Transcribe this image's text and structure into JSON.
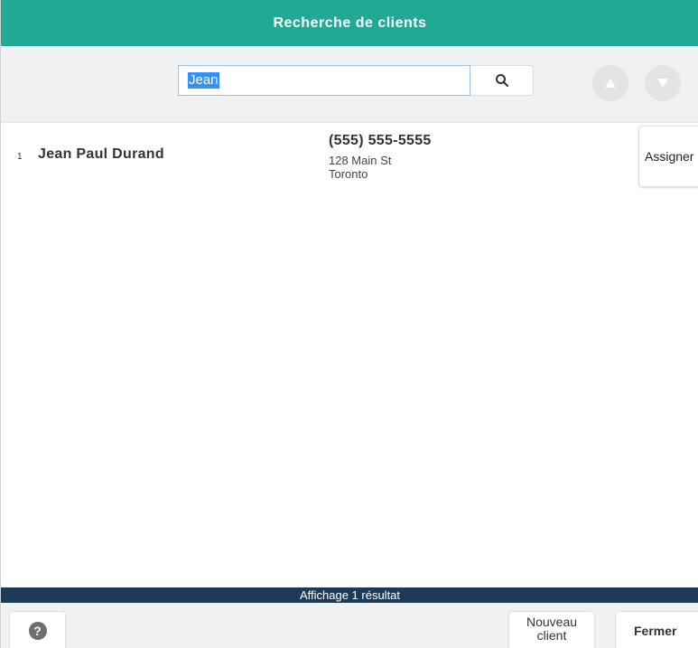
{
  "window": {
    "title": "Recherche de clients"
  },
  "search": {
    "value": "Jean",
    "icon": "search-icon"
  },
  "nav": {
    "up_icon": "triangle-up-icon",
    "down_icon": "triangle-down-icon"
  },
  "results": [
    {
      "index": "1",
      "name": "Jean Paul Durand",
      "phone": "(555) 555-5555",
      "address_line1": "128 Main St",
      "address_line2": "Toronto",
      "action_label": "Assigner"
    }
  ],
  "status": {
    "text": "Affichage 1 résultat"
  },
  "footer": {
    "help_icon": "question-circle-icon",
    "help_glyph": "?",
    "new_client_line1": "Nouveau",
    "new_client_line2": "client",
    "close_label": "Fermer"
  },
  "colors": {
    "header": "#22a994",
    "status_bar": "#1d3a56",
    "selection": "#3390ff"
  }
}
